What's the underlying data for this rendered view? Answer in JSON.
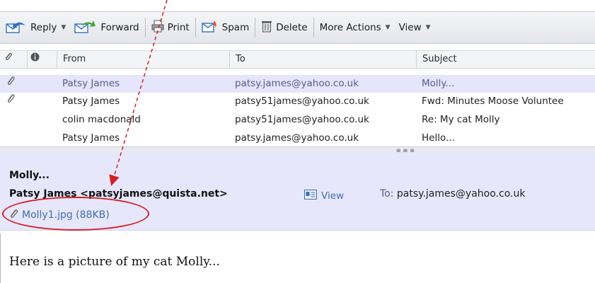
{
  "toolbar": {
    "reply": "Reply",
    "forward": "Forward",
    "print": "Print",
    "spam": "Spam",
    "delete": "Delete",
    "more_actions": "More Actions",
    "view": "View"
  },
  "list": {
    "headers": {
      "from": "From",
      "to": "To",
      "subject": "Subject"
    },
    "rows": [
      {
        "from": "Patsy James",
        "to": "patsy.james@yahoo.co.uk",
        "subject": "Molly...",
        "attachment": true,
        "selected": true
      },
      {
        "from": "Patsy James",
        "to": "patsy51james@yahoo.co.uk",
        "subject": "Fwd: Minutes Moose Voluntee",
        "attachment": true,
        "selected": false
      },
      {
        "from": "colin macdonald",
        "to": "patsy51james@yahoo.co.uk",
        "subject": "Re: My cat Molly",
        "attachment": false,
        "selected": false
      },
      {
        "from": "Patsy James",
        "to": "patsy.james@yahoo.co.uk",
        "subject": "Hello...",
        "attachment": false,
        "selected": false
      }
    ]
  },
  "message": {
    "subject": "Molly...",
    "from": "Patsy James <patsyjames@quista.net>",
    "view_label": "View",
    "to_label": "To:",
    "to_value": "patsy.james@yahoo.co.uk",
    "attachment": "Molly1.jpg (88KB)",
    "body": "Here is a picture of my cat Molly..."
  },
  "colors": {
    "selected_row": "#e5e5fb",
    "link": "#3d6fb0",
    "annotation": "#d42020"
  }
}
